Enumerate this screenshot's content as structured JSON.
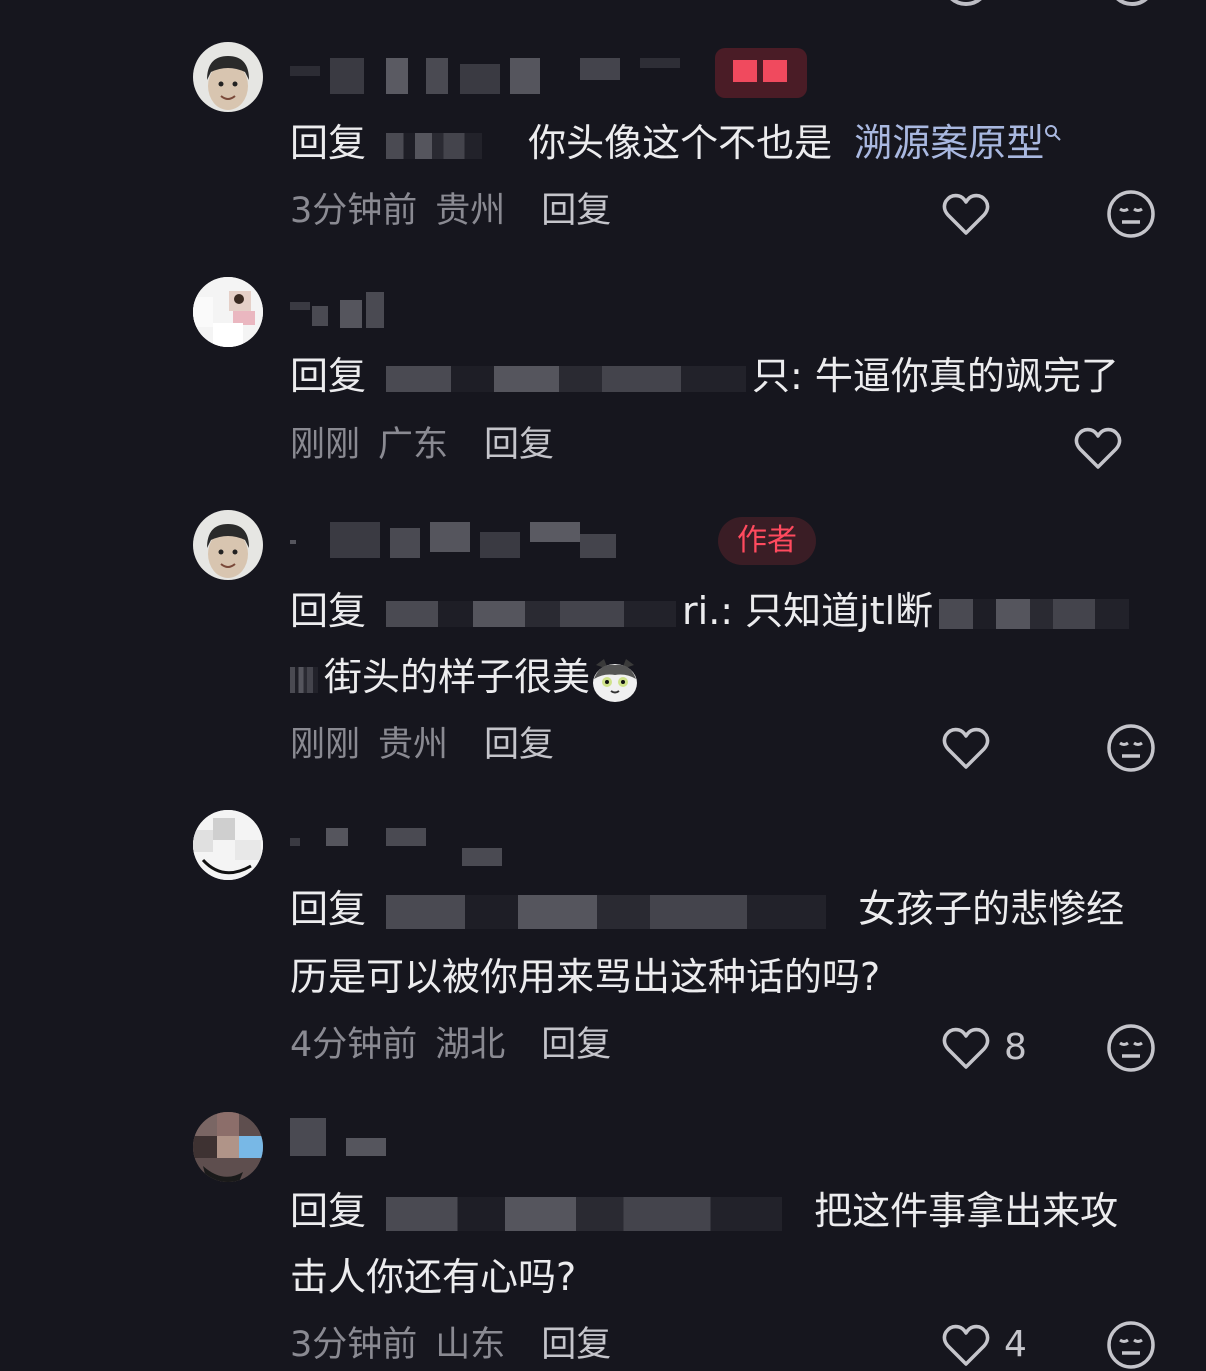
{
  "comments": [
    {
      "reply_prefix": "回复",
      "text_before_link": "你头像这个不也是",
      "link_text": "溯源案原型",
      "time": "3分钟前",
      "location": "贵州",
      "reply_label": "回复",
      "like_count": "",
      "avatar_icon": "avatar-photo"
    },
    {
      "reply_prefix": "回复",
      "text": "只: 牛逼你真的飒完了",
      "time": "刚刚",
      "location": "广东",
      "reply_label": "回复",
      "like_count": ""
    },
    {
      "author_badge": "作者",
      "reply_prefix": "回复",
      "text_line1": "ri.: 只知道jtl断",
      "text_line2": "街头的样子很美",
      "time": "刚刚",
      "location": "贵州",
      "reply_label": "回复",
      "like_count": ""
    },
    {
      "reply_prefix": "回复",
      "text_line1": "女孩子的悲惨经",
      "text_line2": "历是可以被你用来骂出这种话的吗?",
      "time": "4分钟前",
      "location": "湖北",
      "reply_label": "回复",
      "like_count": "8"
    },
    {
      "reply_prefix": "回复",
      "text_line1": "把这件事拿出来攻",
      "text_line2": "击人你还有心吗?",
      "time": "3分钟前",
      "location": "山东",
      "reply_label": "回复",
      "like_count": "4"
    }
  ],
  "icons": {
    "like": "heart-outline-icon",
    "dislike": "meh-face-icon",
    "search": "search-icon",
    "cat_emoji": "cat-emoji-icon"
  },
  "colors": {
    "background": "#16161e",
    "link": "#a9b8e0",
    "author_badge": "#ff4a5e",
    "meta": "#8a8a92"
  }
}
